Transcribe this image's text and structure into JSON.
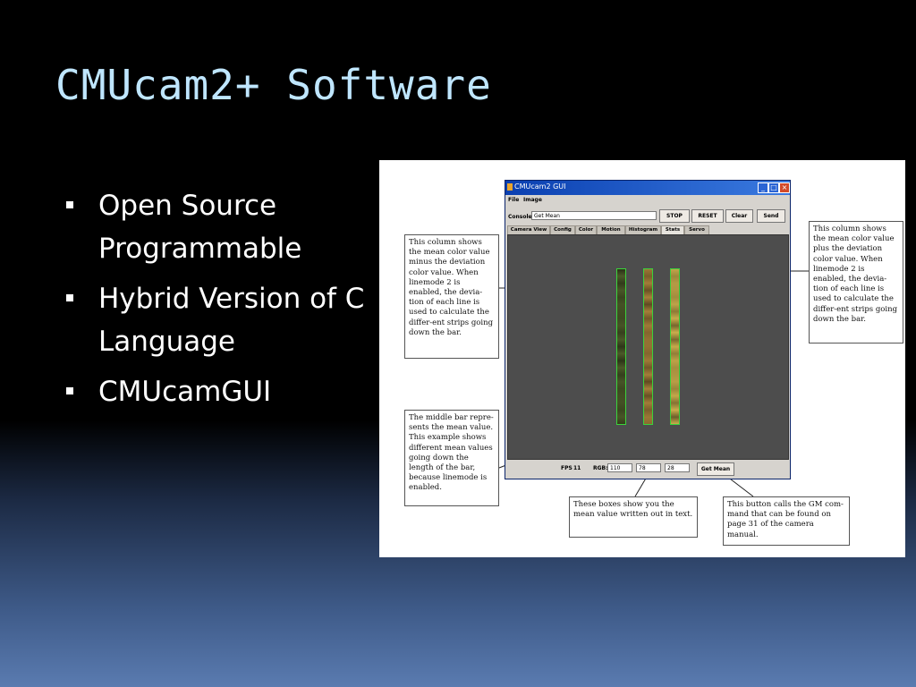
{
  "slide": {
    "title": "CMUcam2+ Software",
    "bullets": [
      {
        "line1": "Open Source",
        "line2": "Programmable"
      },
      {
        "line1": "Hybrid Version of C",
        "line2": "Language"
      },
      {
        "line1": "CMUcamGUI",
        "line2": ""
      }
    ]
  },
  "gui": {
    "window_title": "CMUcam2 GUI",
    "menu": [
      "File",
      "Image"
    ],
    "console_label": "Console:",
    "console_value": "Get Mean",
    "buttons": [
      "STOP",
      "RESET",
      "Clear",
      "Send"
    ],
    "tabs": [
      "Camera View",
      "Config",
      "Color",
      "Motion",
      "Histogram",
      "Stats",
      "Servo"
    ],
    "active_tab": "Stats",
    "fps_label": "FPS",
    "fps_value": "11",
    "rgb_label": "RGB:",
    "rgb_values": [
      "110",
      "78",
      "28"
    ],
    "get_mean_button": "Get Mean",
    "strip_colors": [
      "#3f4a22",
      "#8a6a30",
      "#a89040"
    ]
  },
  "annotations": {
    "left_top": "This column shows the mean color value minus the deviation color value.  When linemode 2 is enabled, the devia-tion of each line is used to calculate the differ-ent strips going down the bar.",
    "right_top": "This column shows the mean color value plus the deviation color value.  When linemode 2 is enabled, the devia-tion of each line is used to calculate the differ-ent strips going down the bar.",
    "left_bottom": "The middle bar repre-sents the mean value. This example shows different mean values going down the length of the bar, because linemode is enabled.",
    "bottom_center": "These boxes show you the mean value written out in text.",
    "bottom_right": "This button calls the GM com-mand that can be found on page 31 of the camera manual."
  }
}
